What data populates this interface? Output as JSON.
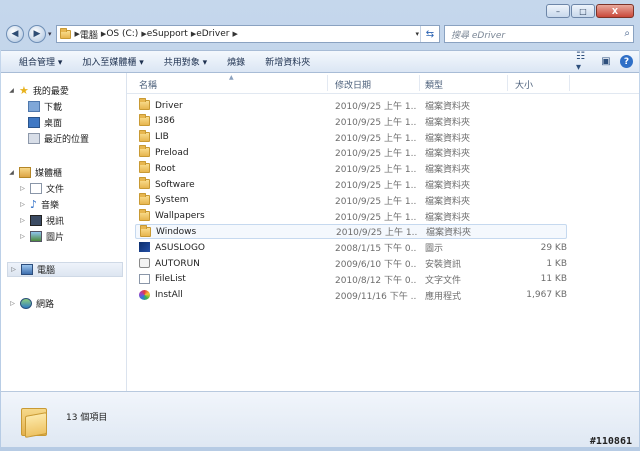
{
  "window": {
    "minimize": "–",
    "maximize": "□",
    "close": "X"
  },
  "address": {
    "crumbs": [
      "電腦",
      "OS (C:)",
      "eSupport",
      "eDriver"
    ],
    "search_placeholder": "搜尋 eDriver"
  },
  "toolbar": {
    "items": [
      "組合管理 ▾",
      "加入至媒體櫃 ▾",
      "共用對象 ▾",
      "燒錄",
      "新增資料夾"
    ]
  },
  "nav": {
    "favorites": "我的最愛",
    "downloads": "下載",
    "desktop": "桌面",
    "recent": "最近的位置",
    "libraries": "媒體櫃",
    "documents": "文件",
    "music": "音樂",
    "videos": "視訊",
    "pictures": "圖片",
    "computer": "電腦",
    "network": "網路"
  },
  "columns": {
    "name": "名稱",
    "date": "修改日期",
    "type": "類型",
    "size": "大小"
  },
  "files": [
    {
      "name": "Driver",
      "date": "2010/9/25 上午 1...",
      "type": "檔案資料夾",
      "size": "",
      "icon": "folder"
    },
    {
      "name": "I386",
      "date": "2010/9/25 上午 1...",
      "type": "檔案資料夾",
      "size": "",
      "icon": "folder"
    },
    {
      "name": "LIB",
      "date": "2010/9/25 上午 1...",
      "type": "檔案資料夾",
      "size": "",
      "icon": "folder"
    },
    {
      "name": "Preload",
      "date": "2010/9/25 上午 1...",
      "type": "檔案資料夾",
      "size": "",
      "icon": "folder"
    },
    {
      "name": "Root",
      "date": "2010/9/25 上午 1...",
      "type": "檔案資料夾",
      "size": "",
      "icon": "folder"
    },
    {
      "name": "Software",
      "date": "2010/9/25 上午 1...",
      "type": "檔案資料夾",
      "size": "",
      "icon": "folder"
    },
    {
      "name": "System",
      "date": "2010/9/25 上午 1...",
      "type": "檔案資料夾",
      "size": "",
      "icon": "folder"
    },
    {
      "name": "Wallpapers",
      "date": "2010/9/25 上午 1...",
      "type": "檔案資料夾",
      "size": "",
      "icon": "folder"
    },
    {
      "name": "Windows",
      "date": "2010/9/25 上午 1...",
      "type": "檔案資料夾",
      "size": "",
      "icon": "folder"
    },
    {
      "name": "ASUSLOGO",
      "date": "2008/1/15 下午 0...",
      "type": "圖示",
      "size": "29 KB",
      "icon": "logo"
    },
    {
      "name": "AUTORUN",
      "date": "2009/6/10 下午 0...",
      "type": "安裝資訊",
      "size": "1 KB",
      "icon": "gear"
    },
    {
      "name": "FileList",
      "date": "2010/8/12 下午 0...",
      "type": "文字文件",
      "size": "11 KB",
      "icon": "doc"
    },
    {
      "name": "InstAll",
      "date": "2009/11/16 下午 ...",
      "type": "應用程式",
      "size": "1,967 KB",
      "icon": "app"
    }
  ],
  "details": {
    "item_count": "13 個項目"
  },
  "watermark": "#110861"
}
